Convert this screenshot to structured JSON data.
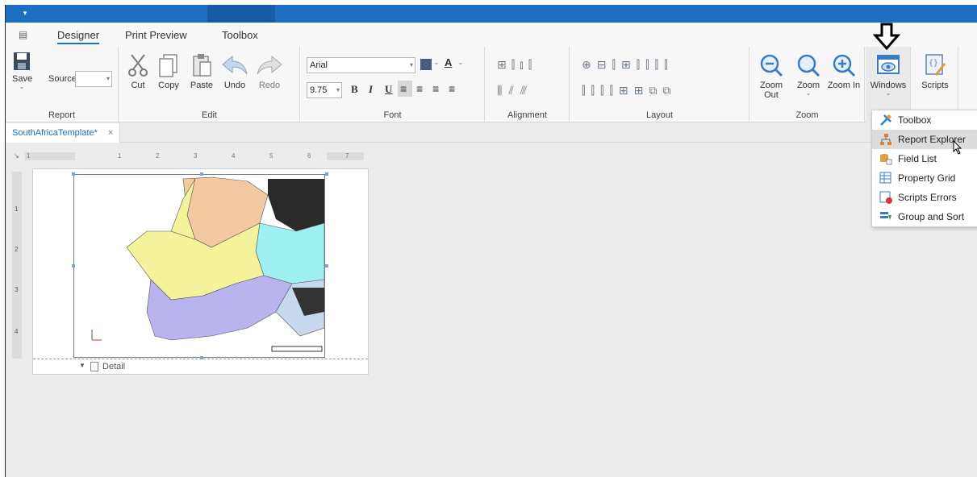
{
  "ribbon_tabs": [
    "Designer",
    "Print Preview",
    "Toolbox"
  ],
  "groups": {
    "report": {
      "label": "Report",
      "save": "Save",
      "source_label": "Source"
    },
    "edit": {
      "label": "Edit",
      "cut": "Cut",
      "copy": "Copy",
      "paste": "Paste",
      "undo": "Undo",
      "redo": "Redo"
    },
    "font": {
      "label": "Font",
      "font_name": "Arial",
      "font_size": "9.75"
    },
    "alignment": {
      "label": "Alignment"
    },
    "layout": {
      "label": "Layout"
    },
    "zoom": {
      "label": "Zoom",
      "zoom_out": "Zoom Out",
      "zoom": "Zoom",
      "zoom_in": "Zoom In"
    },
    "windows": {
      "label": "Windows"
    },
    "scripts": {
      "label": "Scripts"
    }
  },
  "document_tab": {
    "title": "SouthAfricaTemplate*",
    "close": "×"
  },
  "ruler_numbers": [
    "1",
    "2",
    "3",
    "4",
    "5",
    "6",
    "7"
  ],
  "ruler_v_numbers": [
    "1",
    "2",
    "3",
    "4"
  ],
  "band": {
    "label": "Detail"
  },
  "windows_menu": [
    {
      "label": "Toolbox",
      "icon": "tools-icon"
    },
    {
      "label": "Report Explorer",
      "icon": "hierarchy-icon"
    },
    {
      "label": "Field List",
      "icon": "database-icon"
    },
    {
      "label": "Property Grid",
      "icon": "property-grid-icon"
    },
    {
      "label": "Scripts Errors",
      "icon": "script-error-icon"
    },
    {
      "label": "Group and Sort",
      "icon": "group-sort-icon"
    }
  ],
  "colors": {
    "accent": "#1d6fc1"
  }
}
